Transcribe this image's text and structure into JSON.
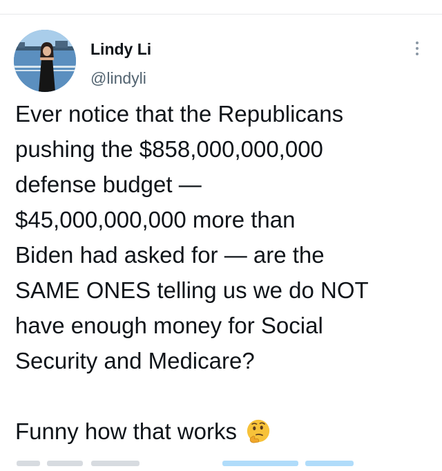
{
  "author": {
    "name": "Lindy Li",
    "handle": "@lindyli"
  },
  "tweet": {
    "lines": [
      "Ever notice that the Republicans",
      "pushing the $858,000,000,000",
      "defense budget —",
      "$45,000,000,000 more than",
      "Biden had asked for — are the",
      "SAME ONES telling us we do NOT",
      "have enough money for Social",
      "Security and Medicare?"
    ],
    "closing": "Funny how that works"
  },
  "icons": {
    "avatar": "profile-photo",
    "more": "more-options-icon",
    "emoji": "thinking-face-icon"
  },
  "colors": {
    "text": "#0f1419",
    "secondary": "#536471",
    "link": "#1d9bf0"
  }
}
